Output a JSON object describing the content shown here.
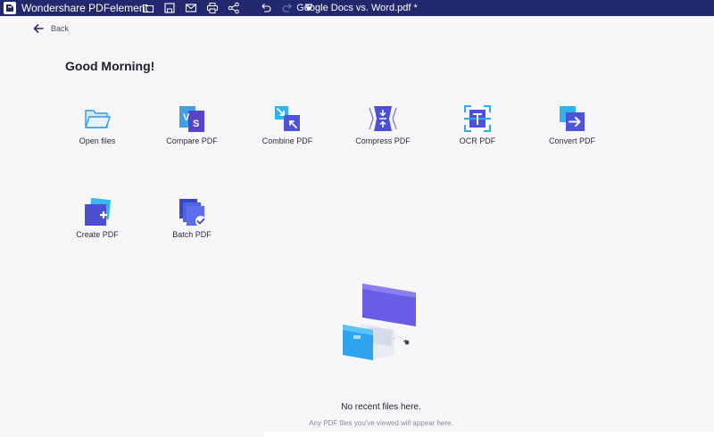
{
  "titlebar": {
    "app_name": "Wondershare PDFelement",
    "document_title": "Google Docs vs. Word.pdf *",
    "tools": [
      "folder-icon",
      "save-icon",
      "mail-icon",
      "print-icon",
      "share-icon",
      "undo-icon",
      "redo-icon",
      "quick-access-menu-icon"
    ]
  },
  "nav": {
    "back_label": "Back"
  },
  "greeting": "Good Morning!",
  "actions": [
    {
      "label": "Open files",
      "icon": "open-files-icon"
    },
    {
      "label": "Compare PDF",
      "icon": "compare-pdf-icon"
    },
    {
      "label": "Combine PDF",
      "icon": "combine-pdf-icon"
    },
    {
      "label": "Compress PDF",
      "icon": "compress-pdf-icon"
    },
    {
      "label": "OCR PDF",
      "icon": "ocr-pdf-icon"
    },
    {
      "label": "Convert PDF",
      "icon": "convert-pdf-icon"
    },
    {
      "label": "Create PDF",
      "icon": "create-pdf-icon"
    },
    {
      "label": "Batch PDF",
      "icon": "batch-pdf-icon"
    }
  ],
  "recent": {
    "empty_title": "No recent files here.",
    "empty_subtitle": "Any PDF files you've viewed will appear here."
  },
  "colors": {
    "titlebar": "#22286e",
    "background": "#f7f7fa",
    "accent_blue": "#4a56e2",
    "accent_cyan": "#2ea8f0",
    "accent_purple": "#6d3fcf"
  }
}
